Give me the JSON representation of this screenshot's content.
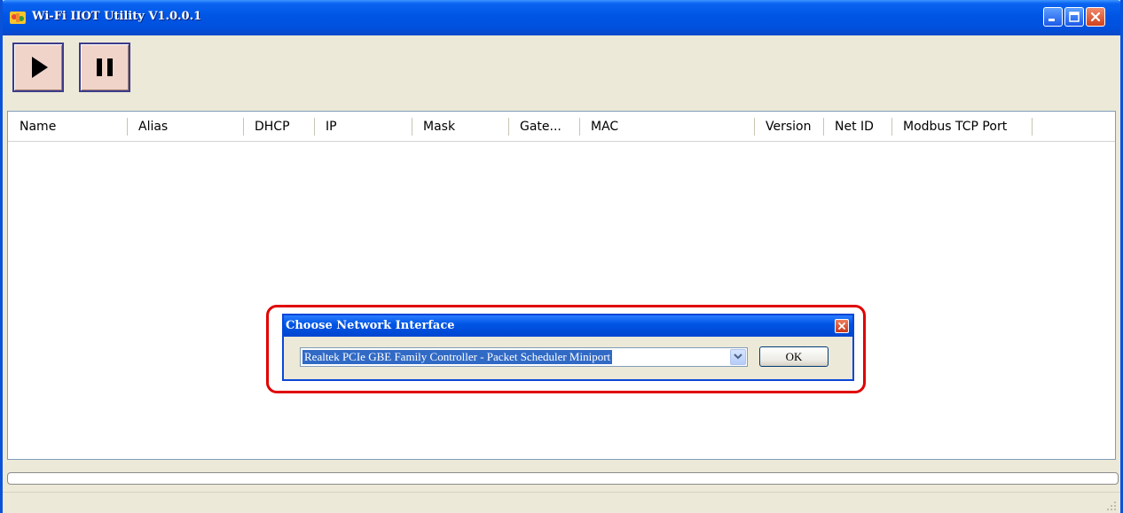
{
  "window": {
    "title": "Wi-Fi IIOT Utility V1.0.0.1",
    "app_icon": "app-logo-icon",
    "controls": {
      "minimize": "minimize-icon",
      "maximize": "maximize-icon",
      "close": "close-icon"
    }
  },
  "toolbar": {
    "buttons": [
      {
        "name": "play",
        "icon": "play-icon"
      },
      {
        "name": "pause",
        "icon": "pause-icon"
      }
    ]
  },
  "list": {
    "columns": [
      "Name",
      "Alias",
      "DHCP",
      "IP",
      "Mask",
      "Gate...",
      "MAC",
      "Version",
      "Net ID",
      "Modbus TCP Port"
    ],
    "rows": []
  },
  "progress": {
    "value": 0
  },
  "dialog": {
    "title": "Choose Network Interface",
    "selected_interface": "Realtek PCIe GBE Family Controller - Packet Scheduler Miniport",
    "ok_label": "OK",
    "close_icon": "close-icon",
    "dropdown_icon": "chevron-down-icon"
  },
  "colors": {
    "title_bar": "#0055e5",
    "window_bg": "#ece9d8",
    "highlight": "#e00000",
    "selection": "#316ac5",
    "tool_button_bg": "#f0d3c9"
  }
}
